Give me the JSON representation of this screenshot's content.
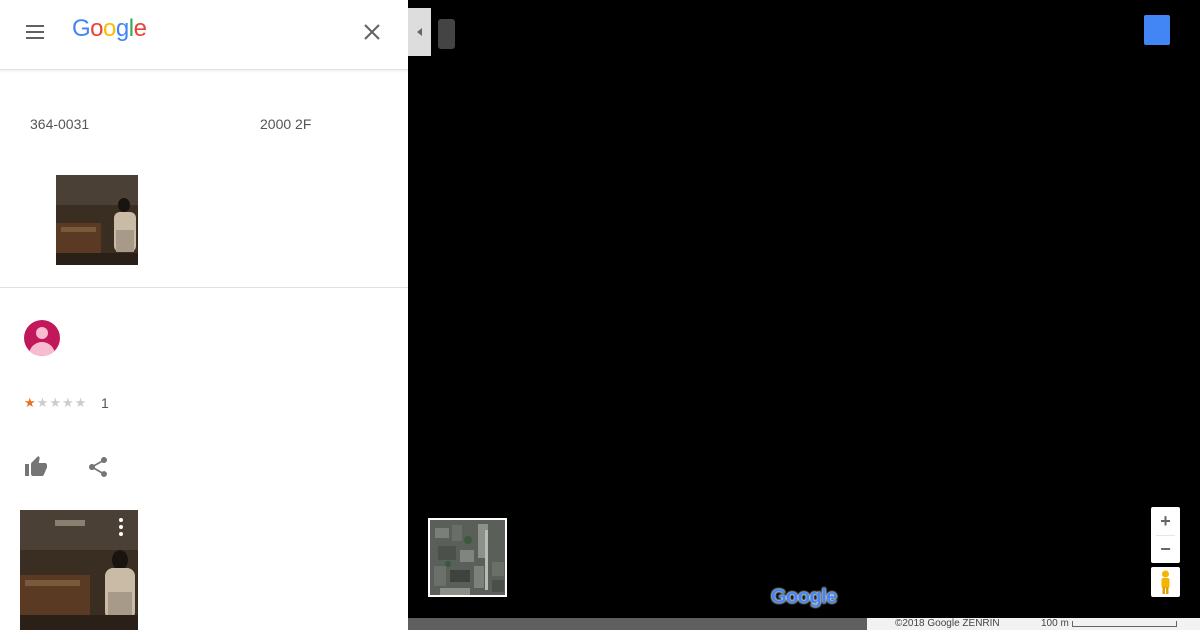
{
  "header": {
    "logo_letters": [
      {
        "char": "G",
        "color": "#4285f4"
      },
      {
        "char": "o",
        "color": "#ea4335"
      },
      {
        "char": "o",
        "color": "#fbbc05"
      },
      {
        "char": "g",
        "color": "#4285f4"
      },
      {
        "char": "l",
        "color": "#34a853"
      },
      {
        "char": "e",
        "color": "#ea4335"
      }
    ],
    "menu_icon": "hamburger-menu-icon",
    "close_icon": "close-icon"
  },
  "place": {
    "postal_code": "364-0031",
    "address_detail": "2000 2F"
  },
  "review": {
    "rating_stars": 1,
    "max_stars": 5,
    "star_filled": "★",
    "star_empty": "★",
    "rating_label": "1",
    "like_icon": "thumb-up-icon",
    "share_icon": "share-icon",
    "more_icon": "more-vert-icon"
  },
  "map": {
    "zoom_in_label": "+",
    "zoom_out_label": "−",
    "logo_text": "Google",
    "copyright": "©2018 Google  ZENRIN",
    "scale_label": "100 m"
  },
  "colors": {
    "accent_blue": "#4285f4",
    "avatar_bg": "#c2185b",
    "star_on": "#e7711b",
    "star_off": "#cccccc",
    "map_bg": "#000000"
  }
}
